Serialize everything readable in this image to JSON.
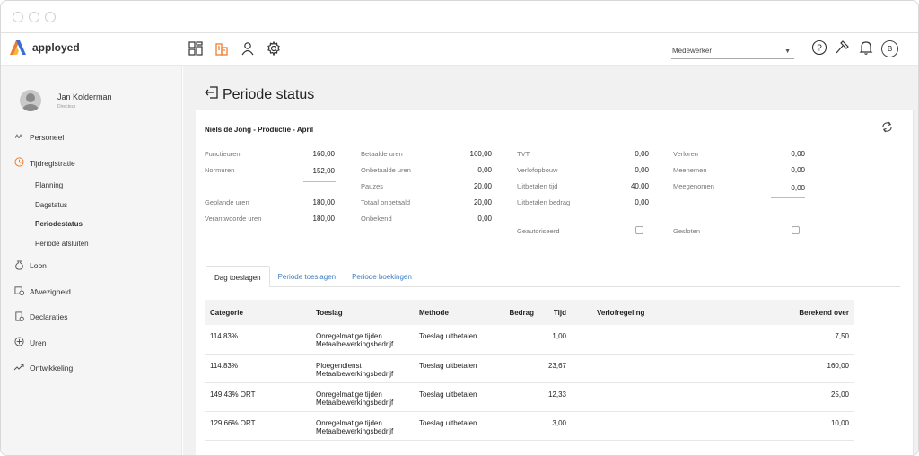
{
  "app": {
    "brand": "apployed",
    "accent": "#f07d2e"
  },
  "topbar": {
    "nav_icons": [
      "dashboard-icon",
      "buildings-icon",
      "person-icon",
      "gear-icon"
    ],
    "employee_select": {
      "value": "Medewerker"
    },
    "right_icons": [
      "help-icon",
      "hammer-icon",
      "bell-icon"
    ],
    "user_badge": "B"
  },
  "sidebar": {
    "user": {
      "name": "Jan Kolderman",
      "role": "Directeur"
    },
    "items": [
      {
        "label": "Personeel",
        "icon": "people-icon"
      },
      {
        "label": "Tijdregistratie",
        "icon": "clock-icon"
      },
      {
        "label": "Loon",
        "icon": "money-bag-icon"
      },
      {
        "label": "Afwezigheid",
        "icon": "calendar-clock-icon"
      },
      {
        "label": "Declaraties",
        "icon": "receipt-icon"
      },
      {
        "label": "Uren",
        "icon": "hours-icon"
      },
      {
        "label": "Ontwikkeling",
        "icon": "trend-icon"
      }
    ],
    "subitems": [
      "Planning",
      "Dagstatus",
      "Periodestatus",
      "Periode afsluiten"
    ]
  },
  "page": {
    "title": "Periode status"
  },
  "summary": {
    "title": "Niels de Jong - Productie - April",
    "col1": [
      {
        "label": "Functieuren",
        "value": "160,00"
      },
      {
        "label": "Normuren",
        "value": "152,00"
      },
      {
        "label": "Geplande uren",
        "value": "180,00"
      },
      {
        "label": "Verantwoorde uren",
        "value": "180,00"
      }
    ],
    "col2": [
      {
        "label": "Betaalde uren",
        "value": "160,00"
      },
      {
        "label": "Onbetaalde uren",
        "value": "0,00"
      },
      {
        "label": "Pauzes",
        "value": "20,00"
      },
      {
        "label": "Totaal onbetaald",
        "value": "20,00"
      },
      {
        "label": "Onbekend",
        "value": "0,00"
      }
    ],
    "col3": [
      {
        "label": "TVT",
        "value": "0,00"
      },
      {
        "label": "Verlofopbouw",
        "value": "0,00"
      },
      {
        "label": "Uitbetalen tijd",
        "value": "40,00"
      },
      {
        "label": "Uitbetalen bedrag",
        "value": "0,00"
      }
    ],
    "col4": [
      {
        "label": "Verloren",
        "value": "0,00"
      },
      {
        "label": "Meenemen",
        "value": "0,00"
      },
      {
        "label": "Meegenomen",
        "value": "0,00"
      }
    ],
    "gautoriseerd_label": "Geautoriseerd",
    "gesloten_label": "Gesloten"
  },
  "tabs": [
    "Dag toeslagen",
    "Periode toeslagen",
    "Periode boekingen"
  ],
  "table": {
    "headers": [
      "Categorie",
      "Toeslag",
      "Methode",
      "Bedrag",
      "Tijd",
      "Verlofregeling",
      "Berekend over"
    ],
    "rows": [
      {
        "categorie": "114.83%",
        "toeslag": "Onregelmatige tijden Metaalbewerkingsbedrijf",
        "methode": "Toeslag uitbetalen",
        "bedrag": "",
        "tijd": "1,00",
        "verlof": "",
        "berekend": "7,50"
      },
      {
        "categorie": "114.83%",
        "toeslag": "Ploegendienst Metaalbewerkingsbedrijf",
        "methode": "Toeslag uitbetalen",
        "bedrag": "",
        "tijd": "23,67",
        "verlof": "",
        "berekend": "160,00"
      },
      {
        "categorie": "149.43% ORT",
        "toeslag": "Onregelmatige tijden Metaalbewerkingsbedrijf",
        "methode": "Toeslag uitbetalen",
        "bedrag": "",
        "tijd": "12,33",
        "verlof": "",
        "berekend": "25,00"
      },
      {
        "categorie": "129.66% ORT",
        "toeslag": "Onregelmatige tijden Metaalbewerkingsbedrijf",
        "methode": "Toeslag uitbetalen",
        "bedrag": "",
        "tijd": "3,00",
        "verlof": "",
        "berekend": "10,00"
      }
    ]
  }
}
